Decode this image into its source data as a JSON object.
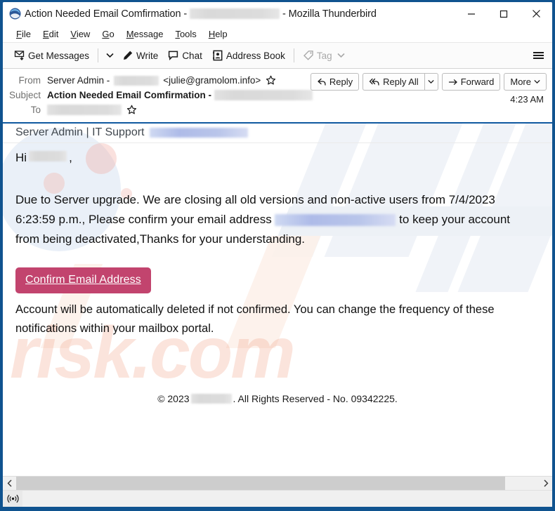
{
  "window": {
    "title_prefix": "Action Needed Email Comfirmation - ",
    "title_suffix": " - Mozilla Thunderbird",
    "app_icon": "thunderbird-icon",
    "minimize_label": "Minimize",
    "maximize_label": "Maximize",
    "close_label": "Close"
  },
  "menubar": {
    "items": [
      {
        "label": "File",
        "accesskey": "F"
      },
      {
        "label": "Edit",
        "accesskey": "E"
      },
      {
        "label": "View",
        "accesskey": "V"
      },
      {
        "label": "Go",
        "accesskey": "G"
      },
      {
        "label": "Message",
        "accesskey": "M"
      },
      {
        "label": "Tools",
        "accesskey": "T"
      },
      {
        "label": "Help",
        "accesskey": "H"
      }
    ]
  },
  "toolbar": {
    "get_messages": "Get Messages",
    "write": "Write",
    "chat": "Chat",
    "address_book": "Address Book",
    "tag": "Tag",
    "app_menu": "app-menu"
  },
  "message_header": {
    "from_label": "From",
    "from_name": "Server Admin - ",
    "from_address": "<julie@gramolom.info>",
    "subject_label": "Subject",
    "subject_text": "Action Needed Email Comfirmation - ",
    "to_label": "To",
    "time": "4:23 AM",
    "actions": {
      "reply": "Reply",
      "reply_all": "Reply All",
      "forward": "Forward",
      "more": "More"
    }
  },
  "email": {
    "sender_line": "Server Admin | IT Support",
    "greeting": "Hi",
    "greeting_comma": ",",
    "paragraph_part1": "Due to Server upgrade. We are closing all old versions and non-active users from 7/4/2023 6:23:59 p.m., Please confirm your email address ",
    "paragraph_part2": " to keep your account from being deactivated,Thanks for your understanding.",
    "cta_label": "Confirm Email Address",
    "warning_text": "Account will be  automatically deleted if not confirmed. You can change the frequency of these notifications within your mailbox portal.",
    "footer_prefix": "© 2023",
    "footer_suffix": ". All Rights Reserved - No. 09342225.",
    "watermark_text": "risk.com"
  },
  "colors": {
    "window_border": "#10538f",
    "header_underline": "#1059a0",
    "cta_background": "#c2446e",
    "redaction_grey": "#dcdcdc",
    "redaction_blue": "#aebbe8"
  },
  "statusbar": {
    "connection_icon": "broadcast-icon"
  },
  "scrollbar": {
    "left_arrow": "chevron-left-icon",
    "right_arrow": "chevron-right-icon"
  }
}
